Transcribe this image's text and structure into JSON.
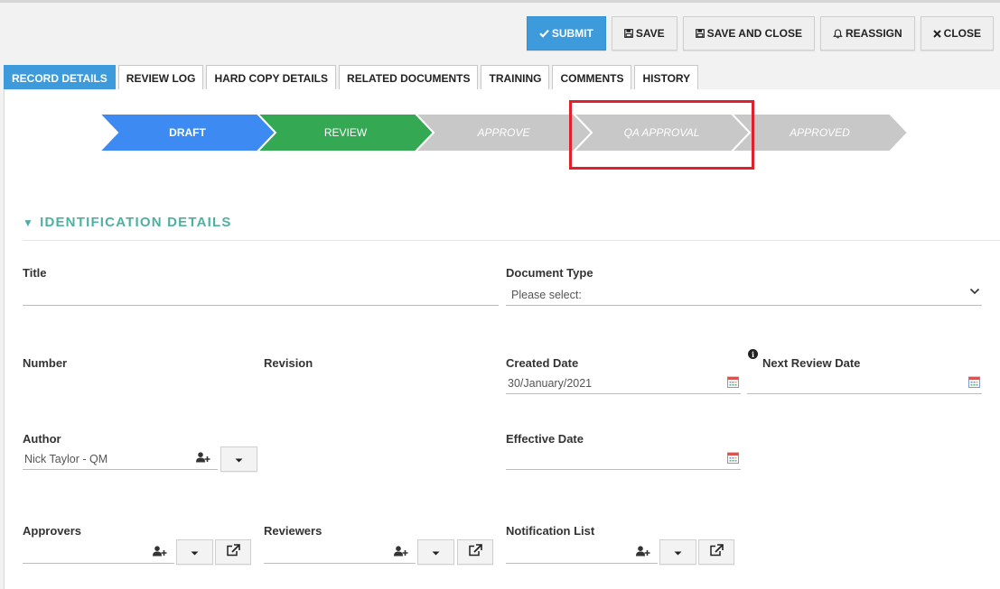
{
  "toolbar": {
    "submit_label": "SUBMIT",
    "save_label": "SAVE",
    "save_close_label": "SAVE AND CLOSE",
    "reassign_label": "REASSIGN",
    "close_label": "CLOSE"
  },
  "tabs": [
    {
      "label": "RECORD DETAILS",
      "active": true
    },
    {
      "label": "REVIEW LOG"
    },
    {
      "label": "HARD COPY DETAILS"
    },
    {
      "label": "RELATED DOCUMENTS"
    },
    {
      "label": "TRAINING"
    },
    {
      "label": "COMMENTS"
    },
    {
      "label": "HISTORY"
    }
  ],
  "workflow": {
    "steps": [
      {
        "label": "DRAFT",
        "state": "current",
        "color": "#3d8bf2"
      },
      {
        "label": "REVIEW",
        "state": "done",
        "color": "#34a853"
      },
      {
        "label": "APPROVE",
        "state": "pending",
        "color": "#c8c8c8"
      },
      {
        "label": "QA APPROVAL",
        "state": "pending",
        "color": "#c8c8c8"
      },
      {
        "label": "APPROVED",
        "state": "pending",
        "color": "#c8c8c8"
      }
    ]
  },
  "section": {
    "title": "IDENTIFICATION DETAILS",
    "icon": "triangle-down-icon"
  },
  "form": {
    "title_label": "Title",
    "title_value": "",
    "doc_type_label": "Document Type",
    "doc_type_value": "Please select:",
    "number_label": "Number",
    "revision_label": "Revision",
    "created_label": "Created Date",
    "created_value": "30/January/2021",
    "next_review_label": "Next Review Date",
    "next_review_value": "",
    "author_label": "Author",
    "author_value": "Nick Taylor - QM",
    "effective_label": "Effective Date",
    "effective_value": "",
    "approvers_label": "Approvers",
    "reviewers_label": "Reviewers",
    "notification_label": "Notification List"
  },
  "colors": {
    "accent": "#3d9bdc",
    "section": "#4eb0a2",
    "highlight": "#e0202a"
  }
}
